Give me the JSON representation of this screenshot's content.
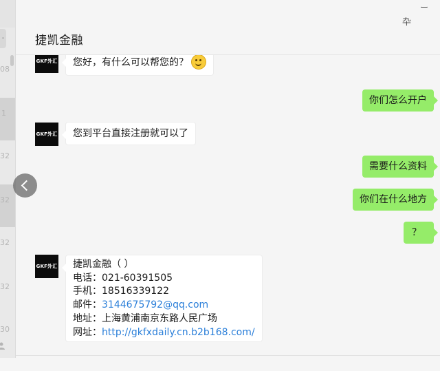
{
  "window": {
    "title": "捷凯金融",
    "minimize_glyph": "ー",
    "pin_glyph": "卆"
  },
  "sidebar_strip": {
    "numbers": [
      "08",
      "1",
      "32",
      "32",
      "32",
      "32",
      "30"
    ],
    "top_tab_glyph": "-"
  },
  "messages": {
    "m1": {
      "sender": "left",
      "avatar_text": "GKF外汇",
      "text": "您好，有什么可以帮您的？",
      "emoji": "smile-icon"
    },
    "m2": {
      "sender": "right",
      "text": "你们怎么开户"
    },
    "m3": {
      "sender": "left",
      "avatar_text": "GKF外汇",
      "text": "您到平台直接注册就可以了"
    },
    "m4": {
      "sender": "right",
      "text": "需要什么资料"
    },
    "m5": {
      "sender": "right",
      "text": "你们在什么地方"
    },
    "m6": {
      "sender": "right",
      "text": "？"
    },
    "m7": {
      "sender": "left",
      "avatar_text": "GKF外汇",
      "lines": {
        "name": "捷凯金融（ ）",
        "phone": "电话：021-60391505",
        "mobile_label": "手机：",
        "mobile": "18516339122",
        "mail_label": "邮件：",
        "mail": "3144675792@qq.com",
        "address": "地址：上海黄浦南京东路人民广场",
        "web_label": "网址：",
        "web": "http://gkfxdaily.cn.b2b168.com/"
      }
    }
  },
  "colors": {
    "background": "#f5f5f5",
    "bubble_self": "#95ec69",
    "bubble_other": "#ffffff",
    "link": "#2b7fd9"
  }
}
